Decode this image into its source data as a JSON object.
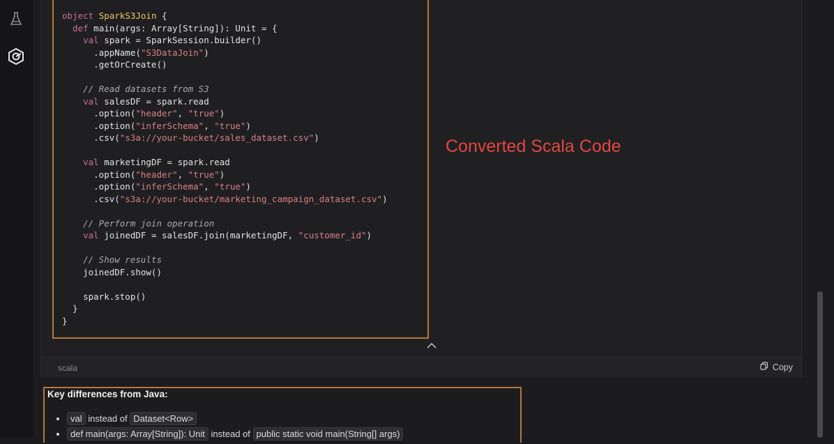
{
  "sidebar": {
    "icons": [
      "flask-icon",
      "hexagon-logo-icon"
    ]
  },
  "code_block": {
    "lines": [
      {
        "segs": [
          {
            "t": "object ",
            "c": "kw"
          },
          {
            "t": "SparkS3Join",
            "c": "obj"
          },
          {
            "t": " {",
            "c": ""
          }
        ]
      },
      {
        "segs": [
          {
            "t": "  ",
            "c": ""
          },
          {
            "t": "def",
            "c": "kw"
          },
          {
            "t": " main(args: Array[String]): Unit = {",
            "c": ""
          }
        ]
      },
      {
        "segs": [
          {
            "t": "    ",
            "c": ""
          },
          {
            "t": "val",
            "c": "kw"
          },
          {
            "t": " spark = SparkSession.builder()",
            "c": ""
          }
        ]
      },
      {
        "segs": [
          {
            "t": "      .appName(",
            "c": ""
          },
          {
            "t": "\"S3DataJoin\"",
            "c": "str"
          },
          {
            "t": ")",
            "c": ""
          }
        ]
      },
      {
        "segs": [
          {
            "t": "      .getOrCreate()",
            "c": ""
          }
        ]
      },
      {
        "segs": [
          {
            "t": "",
            "c": ""
          }
        ]
      },
      {
        "segs": [
          {
            "t": "    // Read datasets from S3",
            "c": "cm"
          }
        ]
      },
      {
        "segs": [
          {
            "t": "    ",
            "c": ""
          },
          {
            "t": "val",
            "c": "kw"
          },
          {
            "t": " salesDF = spark.read",
            "c": ""
          }
        ]
      },
      {
        "segs": [
          {
            "t": "      .option(",
            "c": ""
          },
          {
            "t": "\"header\"",
            "c": "str"
          },
          {
            "t": ", ",
            "c": ""
          },
          {
            "t": "\"true\"",
            "c": "str"
          },
          {
            "t": ")",
            "c": ""
          }
        ]
      },
      {
        "segs": [
          {
            "t": "      .option(",
            "c": ""
          },
          {
            "t": "\"inferSchema\"",
            "c": "str"
          },
          {
            "t": ", ",
            "c": ""
          },
          {
            "t": "\"true\"",
            "c": "str"
          },
          {
            "t": ")",
            "c": ""
          }
        ]
      },
      {
        "segs": [
          {
            "t": "      .csv(",
            "c": ""
          },
          {
            "t": "\"s3a://your-bucket/sales_dataset.csv\"",
            "c": "str"
          },
          {
            "t": ")",
            "c": ""
          }
        ]
      },
      {
        "segs": [
          {
            "t": "",
            "c": ""
          }
        ]
      },
      {
        "segs": [
          {
            "t": "    ",
            "c": ""
          },
          {
            "t": "val",
            "c": "kw"
          },
          {
            "t": " marketingDF = spark.read",
            "c": ""
          }
        ]
      },
      {
        "segs": [
          {
            "t": "      .option(",
            "c": ""
          },
          {
            "t": "\"header\"",
            "c": "str"
          },
          {
            "t": ", ",
            "c": ""
          },
          {
            "t": "\"true\"",
            "c": "str"
          },
          {
            "t": ")",
            "c": ""
          }
        ]
      },
      {
        "segs": [
          {
            "t": "      .option(",
            "c": ""
          },
          {
            "t": "\"inferSchema\"",
            "c": "str"
          },
          {
            "t": ", ",
            "c": ""
          },
          {
            "t": "\"true\"",
            "c": "str"
          },
          {
            "t": ")",
            "c": ""
          }
        ]
      },
      {
        "segs": [
          {
            "t": "      .csv(",
            "c": ""
          },
          {
            "t": "\"s3a://your-bucket/marketing_campaign_dataset.csv\"",
            "c": "str"
          },
          {
            "t": ")",
            "c": ""
          }
        ]
      },
      {
        "segs": [
          {
            "t": "",
            "c": ""
          }
        ]
      },
      {
        "segs": [
          {
            "t": "    // Perform join operation",
            "c": "cm"
          }
        ]
      },
      {
        "segs": [
          {
            "t": "    ",
            "c": ""
          },
          {
            "t": "val",
            "c": "kw"
          },
          {
            "t": " joinedDF = salesDF.join(marketingDF, ",
            "c": ""
          },
          {
            "t": "\"customer_id\"",
            "c": "str"
          },
          {
            "t": ")",
            "c": ""
          }
        ]
      },
      {
        "segs": [
          {
            "t": "",
            "c": ""
          }
        ]
      },
      {
        "segs": [
          {
            "t": "    // Show results",
            "c": "cm"
          }
        ]
      },
      {
        "segs": [
          {
            "t": "    joinedDF.show()",
            "c": ""
          }
        ]
      },
      {
        "segs": [
          {
            "t": "",
            "c": ""
          }
        ]
      },
      {
        "segs": [
          {
            "t": "    spark.stop()",
            "c": ""
          }
        ]
      },
      {
        "segs": [
          {
            "t": "  }",
            "c": ""
          }
        ]
      },
      {
        "segs": [
          {
            "t": "}",
            "c": ""
          }
        ]
      }
    ],
    "language": "scala",
    "copy_label": "Copy"
  },
  "overlay_title": "Converted Scala Code",
  "notes": {
    "title": "Key differences from Java:",
    "items": [
      {
        "parts": [
          {
            "t": "val",
            "code": true
          },
          {
            "t": " instead of ",
            "code": false
          },
          {
            "t": "Dataset<Row>",
            "code": true
          }
        ]
      },
      {
        "parts": [
          {
            "t": "def main(args: Array[String]): Unit",
            "code": true
          },
          {
            "t": " instead of ",
            "code": false
          },
          {
            "t": "public static void main(String[] args)",
            "code": true
          }
        ]
      }
    ]
  }
}
